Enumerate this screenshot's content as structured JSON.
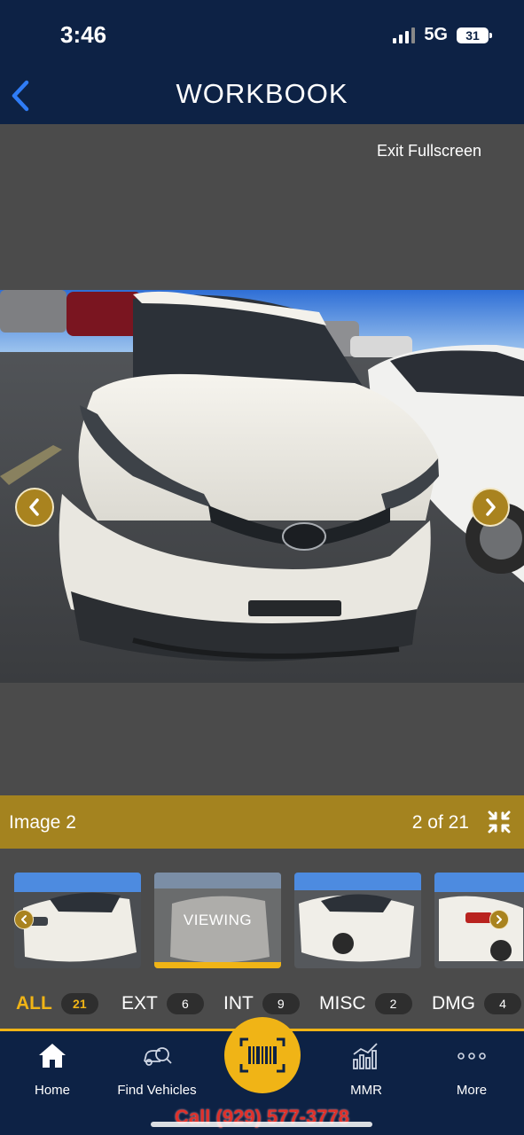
{
  "status": {
    "time": "3:46",
    "network": "5G",
    "battery": "31"
  },
  "header": {
    "title": "WORKBOOK",
    "back_icon": "chevron-left-icon"
  },
  "viewer": {
    "exit_label": "Exit Fullscreen",
    "prev_icon": "chevron-left-icon",
    "next_icon": "chevron-right-icon"
  },
  "caption": {
    "title": "Image 2",
    "count": "2 of 21",
    "collapse_icon": "collapse-arrows-icon"
  },
  "thumbnails": {
    "viewing_label": "VIEWING",
    "current_index": 2
  },
  "filters": [
    {
      "label": "ALL",
      "count": "21",
      "active": true
    },
    {
      "label": "EXT",
      "count": "6",
      "active": false
    },
    {
      "label": "INT",
      "count": "9",
      "active": false
    },
    {
      "label": "MISC",
      "count": "2",
      "active": false
    },
    {
      "label": "DMG",
      "count": "4",
      "active": false
    }
  ],
  "tabbar": {
    "home": "Home",
    "find": "Find Vehicles",
    "mmr": "MMR",
    "more": "More",
    "scan_icon": "barcode-scan-icon"
  },
  "call_banner": "Call (929) 577-3778",
  "colors": {
    "navy": "#0d2245",
    "gold": "#a4831f",
    "accent_yellow": "#f0b416",
    "viewer_gray": "#4b4b4b",
    "call_red": "#e0302a"
  }
}
